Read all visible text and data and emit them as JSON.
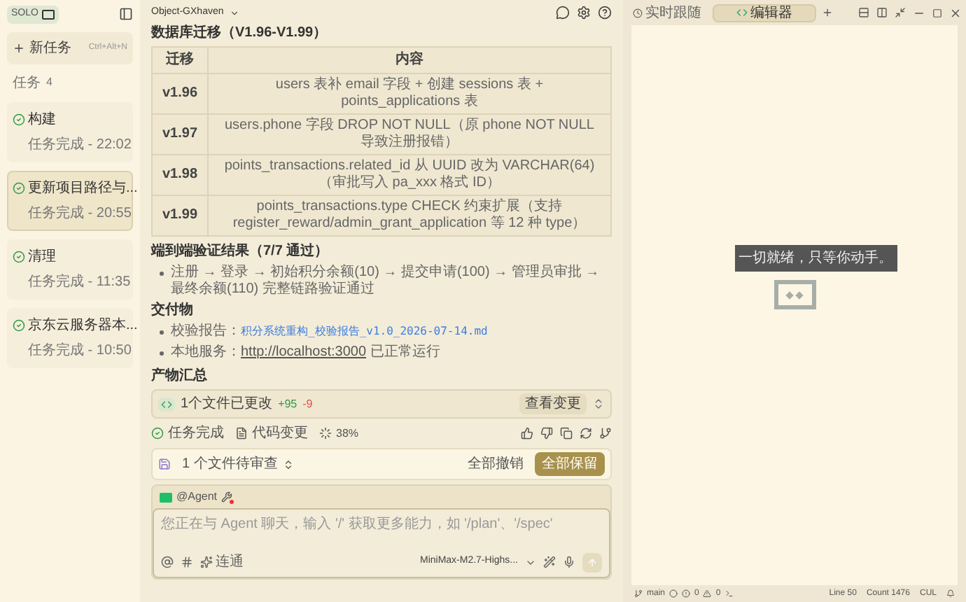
{
  "sidebar": {
    "brand": "SOLO",
    "new_task": {
      "label": "新任务",
      "shortcut": "Ctrl+Alt+N"
    },
    "tasks_label": "任务",
    "tasks_count": "4",
    "tasks": [
      {
        "title": "构建",
        "status": "任务完成 - 22:02",
        "selected": false
      },
      {
        "title": "更新项目路径与...",
        "status": "任务完成 - 20:55",
        "selected": true
      },
      {
        "title": "清理",
        "status": "任务完成 - 11:35",
        "selected": false
      },
      {
        "title": "京东云服务器本...",
        "status": "任务完成 - 10:50",
        "selected": false
      }
    ]
  },
  "project": {
    "title": "Object-GXhaven"
  },
  "content": {
    "section_title": "数据库迁移（V1.96-V1.99）",
    "table": {
      "columns": [
        "迁移",
        "内容"
      ],
      "rows": [
        [
          "v1.96",
          "users 表补 email 字段 + 创建 sessions 表 + points_applications 表"
        ],
        [
          "v1.97",
          "users.phone 字段 DROP NOT NULL（原 phone NOT NULL 导致注册报错）"
        ],
        [
          "v1.98",
          "points_transactions.related_id 从 UUID 改为 VARCHAR(64)（审批写入 pa_xxx 格式 ID）"
        ],
        [
          "v1.99",
          "points_transactions.type CHECK 约束扩展（支持 register_reward/admin_grant_application 等 12 种 type）"
        ]
      ]
    },
    "verify_title": "端到端验证结果（7/7 通过）",
    "verify_items": [
      "注册 → 登录 → 初始积分余额(10) → 提交申请(100) → 管理员审批 → 最终余额(110) 完整链路验证通过"
    ],
    "deliverables_title": "交付物",
    "deliverables": [
      {
        "kind": "file",
        "label": "校验报告：",
        "link": "积分系统重构_校验报告_v1.0_2026-07-14.md"
      },
      {
        "kind": "url",
        "label": "本地服务：",
        "link": "http://localhost:3000",
        "suffix": "已正常运行"
      }
    ],
    "summary_title": "产物汇总"
  },
  "changes": {
    "label": "1个文件已更改",
    "added": "+95",
    "removed": "-9",
    "button": "查看变更"
  },
  "task_status": {
    "done": "任务完成",
    "code": "代码变更",
    "percent": "38%"
  },
  "review": {
    "label": "1 个文件待审查",
    "reject": "全部撤销",
    "accept": "全部保留"
  },
  "composer": {
    "agent": "@Agent",
    "placeholder": "您正在与 Agent 聊天，输入 '/' 获取更多能力，如 '/plan'、'/spec'",
    "mode": "连通",
    "model": "MiniMax-M2.7-Highs..."
  },
  "right": {
    "tabs": [
      {
        "label": "实时跟随",
        "selected": false
      },
      {
        "label": "编辑器",
        "selected": true
      }
    ],
    "tooltip": "一切就绪，只等你动手。"
  },
  "status_bar": {
    "branch": "main",
    "errors": "0",
    "warnings": "0",
    "line": "Line 50",
    "count": "Count 1476",
    "eol": "CUL"
  }
}
